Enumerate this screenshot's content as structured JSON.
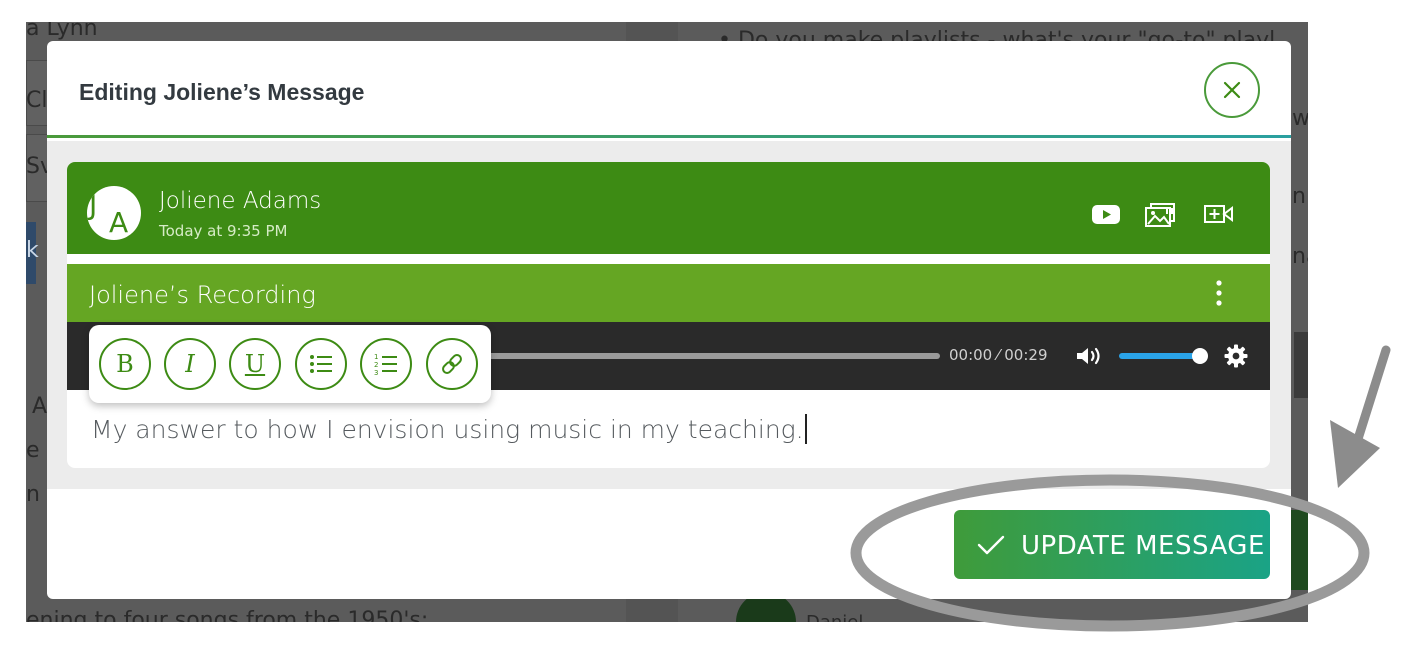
{
  "background": {
    "text_fragments": [
      "a Lynn",
      "Cli",
      "Sv",
      "k",
      "A",
      "e",
      "n",
      "ening to four songs from the 1950's:",
      "• Do you make playlists - what's your \"go-to\" playl",
      "wa",
      "ni",
      "na",
      "Daniel"
    ]
  },
  "modal": {
    "title": "Editing Joliene’s Message",
    "close_icon": "close-x-icon"
  },
  "message": {
    "avatar_initials": [
      "J",
      "A"
    ],
    "author": "Joliene Adams",
    "timestamp": "Today at 9:35 PM",
    "header_icons": [
      "youtube-icon",
      "image-gallery-icon",
      "add-video-icon"
    ],
    "recording_title": "Joliene’s Recording",
    "body_text": "My answer to how I envision using music in my teaching."
  },
  "player": {
    "time": "00:00 ⁄ 00:29",
    "volume": 0.9,
    "icons": [
      "volume-icon",
      "settings-icon"
    ]
  },
  "toolbar": {
    "bold": "B",
    "italic": "I",
    "underline": "U",
    "icons": [
      "bullet-list-icon",
      "numbered-list-icon",
      "link-icon"
    ]
  },
  "actions": {
    "update_label": "UPDATE MESSAGE"
  },
  "colors": {
    "primary_green": "#3d8b14",
    "recording_green": "#65a623",
    "button_gradient_start": "#3f9b3a",
    "button_gradient_end": "#1aa386",
    "volume_blue": "#2aa3e8",
    "annotation_gray": "#9a9a9a"
  }
}
